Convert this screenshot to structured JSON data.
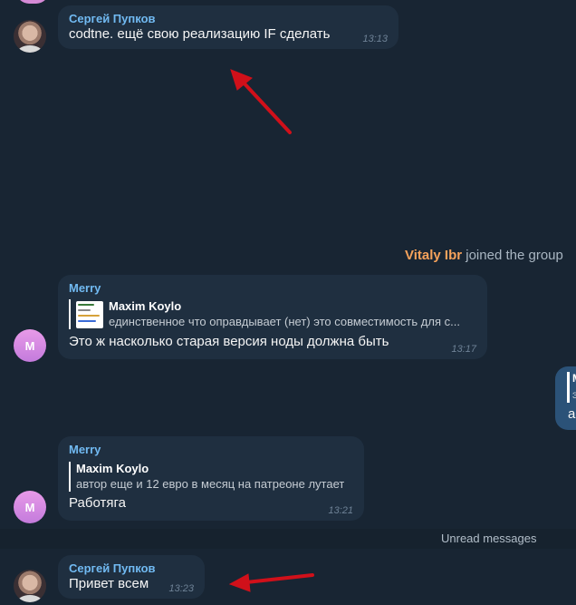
{
  "messages": [
    {
      "sender": "Сергей Пупков",
      "text": "codtne. ещё свою реализацию IF сделать",
      "time": "13:13"
    },
    {
      "sender": "Merry",
      "avatar_letter": "M",
      "reply_author": "Maxim Koylo",
      "reply_text": "единственное что оправдывает (нет) это совместимость для с...",
      "text": "Это ж насколько старая версия ноды должна быть",
      "time": "13:17"
    },
    {
      "sender": "Merry",
      "avatar_letter": "M",
      "reply_author": "Maxim Koylo",
      "reply_text": "автор еще и 12 евро в месяц на патреоне лутает",
      "text": "Работяга",
      "time": "13:21"
    },
    {
      "sender": "Сергей Пупков",
      "text": "Привет всем",
      "time": "13:23"
    }
  ],
  "service": {
    "name": "Vitaly Ibr",
    "action": " joined the group"
  },
  "unread_label": "Unread messages",
  "right_bubble": {
    "reply_initial": "M",
    "reply_text_initial": "э",
    "text_initial": "а"
  },
  "colors": {
    "background": "#182533",
    "bubble_in": "#1f2f40",
    "bubble_out": "#2b5278",
    "sender_name": "#71baf2",
    "service_name": "#f6a25b",
    "annotation_arrow": "#d0101a"
  }
}
